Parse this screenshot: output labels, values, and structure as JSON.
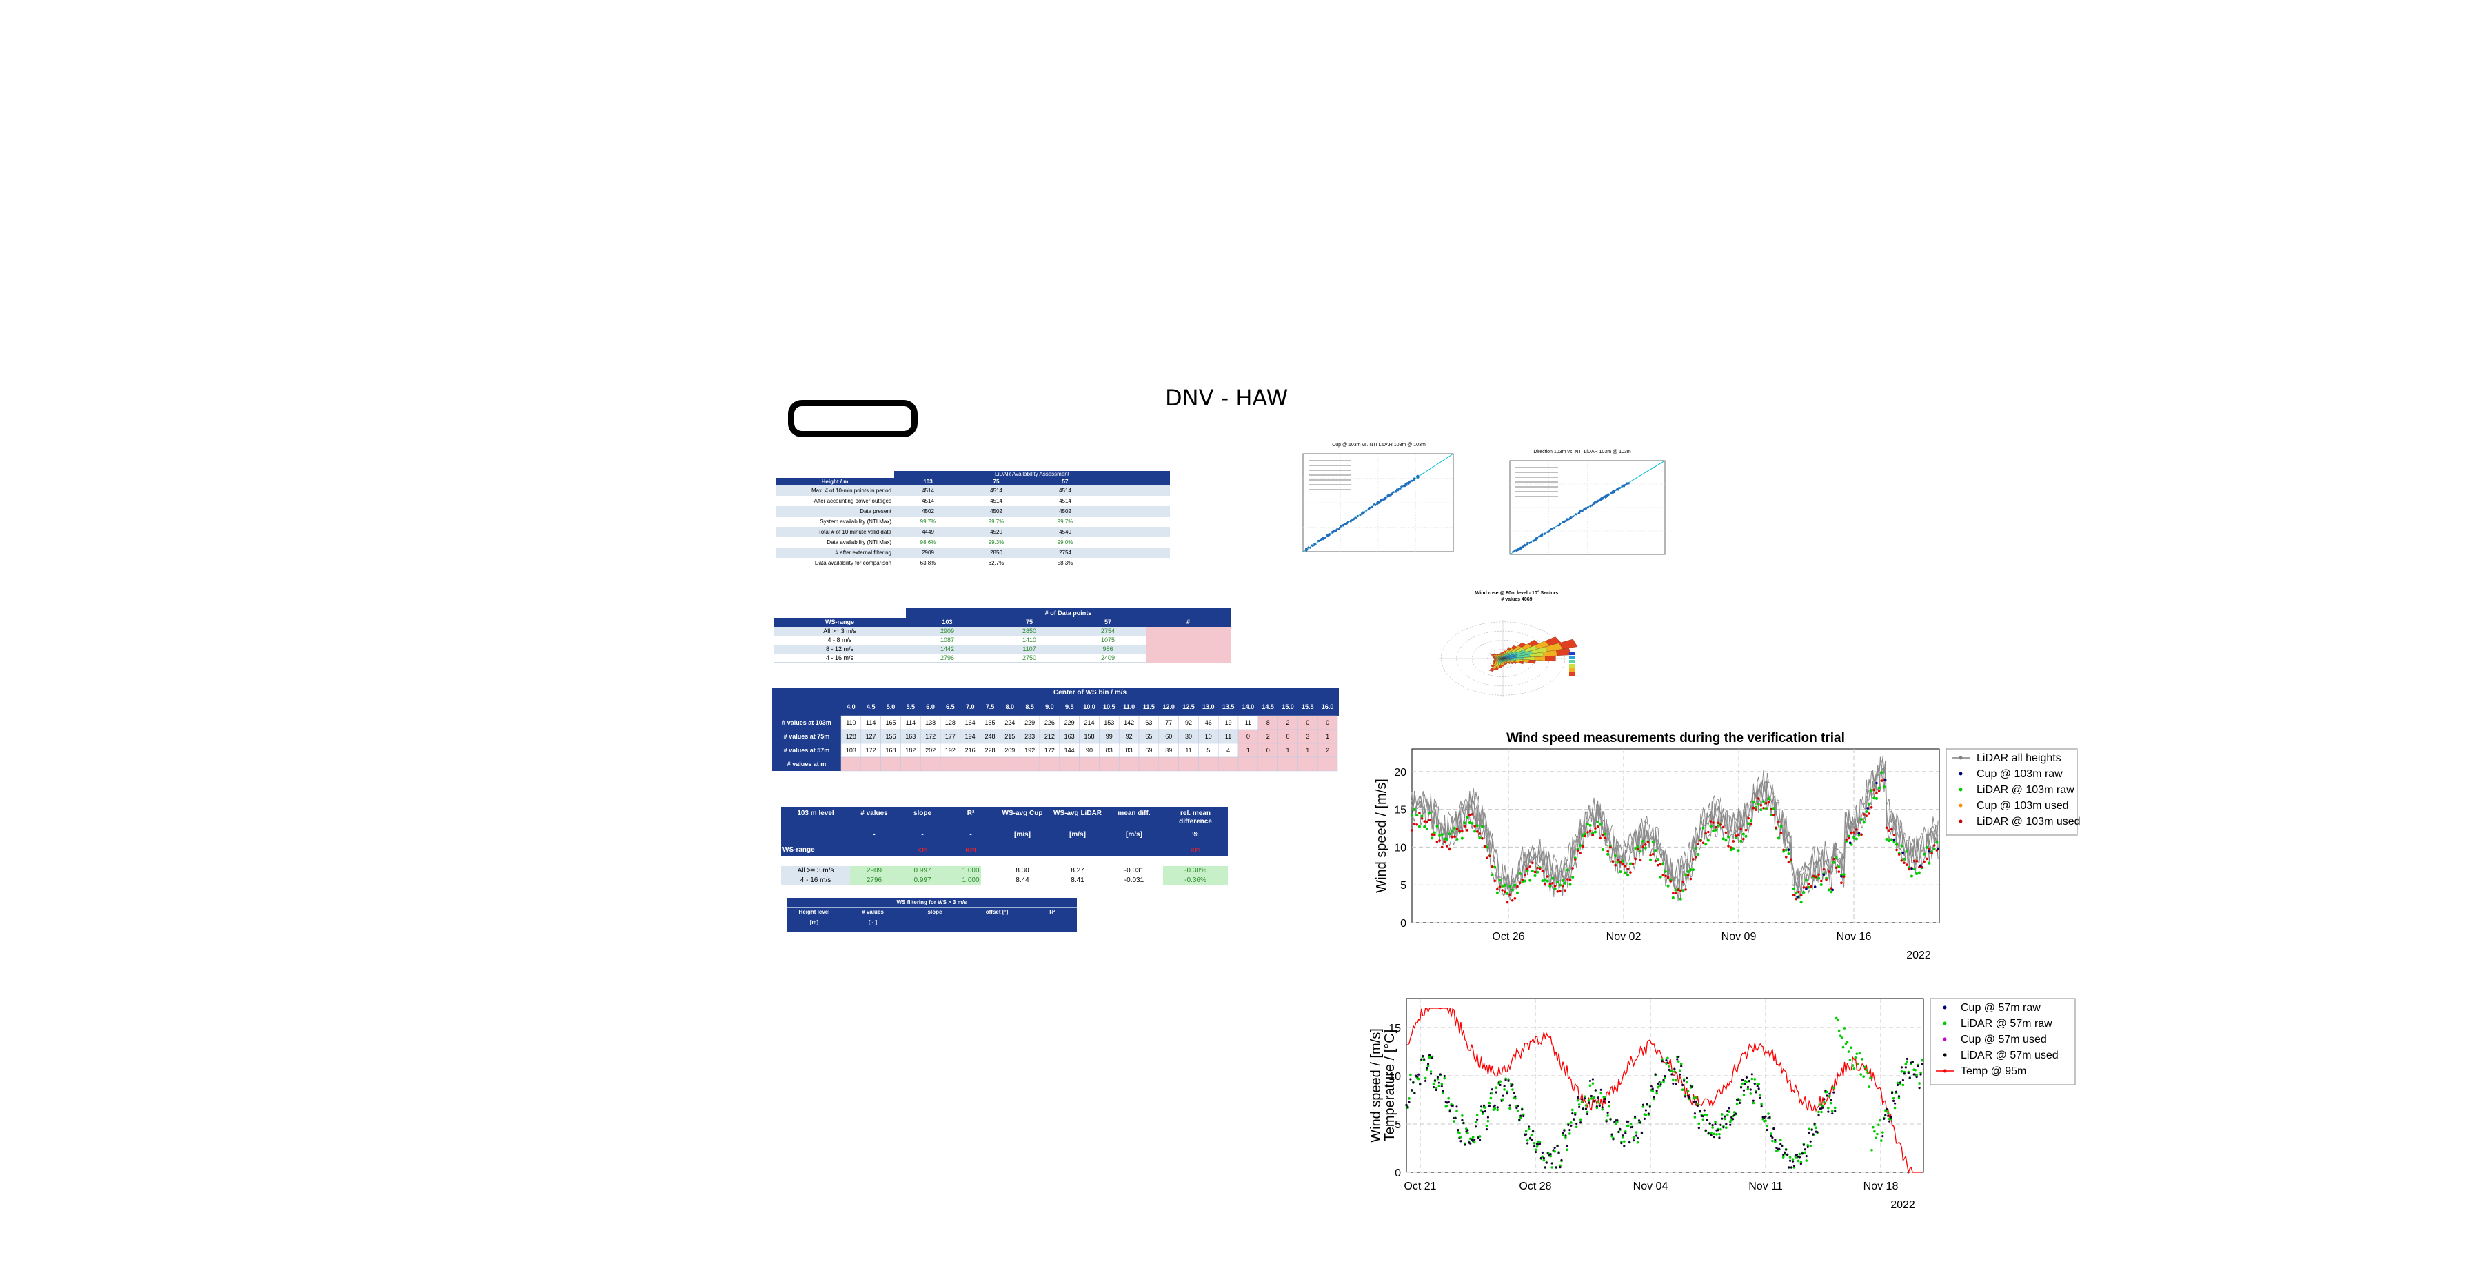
{
  "slide": {
    "title": "DNV - HAW"
  },
  "avail_table": {
    "super_header": "LiDAR Availability Assessment",
    "col_header": [
      "Height / m",
      "103",
      "75",
      "57"
    ],
    "rows": [
      [
        "Max. # of 10-min points in period",
        "4514",
        "4514",
        "4514"
      ],
      [
        "After accounting power outages",
        "4514",
        "4514",
        "4514"
      ],
      [
        "Data present",
        "4502",
        "4502",
        "4502"
      ],
      [
        "System availability (NTI Max)",
        "99.7%",
        "99.7%",
        "99.7%"
      ],
      [
        "Total # of 10 minute valid data",
        "4449",
        "4520",
        "4540"
      ],
      [
        "Data availability (NTI Max)",
        "98.6%",
        "99.3%",
        "99.0%"
      ],
      [
        "# after external filtering",
        "2909",
        "2850",
        "2754"
      ],
      [
        "Data availability for comparison",
        "63.8%",
        "62.7%",
        "58.3%"
      ]
    ]
  },
  "points_table": {
    "super_header": "# of Data points",
    "col_header": [
      "WS-range",
      "103",
      "75",
      "57",
      "#"
    ],
    "rows": [
      [
        "All >= 3 m/s",
        "2909",
        "2850",
        "2754",
        ""
      ],
      [
        "4 - 8 m/s",
        "1087",
        "1410",
        "1075",
        ""
      ],
      [
        "8 - 12 m/s",
        "1442",
        "1107",
        "986",
        ""
      ],
      [
        "4 - 16 m/s",
        "2796",
        "2750",
        "2409",
        ""
      ]
    ]
  },
  "bins_table": {
    "super_header": "Center of WS bin / m/s",
    "bins": [
      "4.0",
      "4.5",
      "5.0",
      "5.5",
      "6.0",
      "6.5",
      "7.0",
      "7.5",
      "8.0",
      "8.5",
      "9.0",
      "9.5",
      "10.0",
      "10.5",
      "11.0",
      "11.5",
      "12.0",
      "12.5",
      "13.0",
      "13.5",
      "14.0",
      "14.5",
      "15.0",
      "15.5",
      "16.0"
    ],
    "rows": [
      {
        "label": "# values at 103m",
        "values": [
          "110",
          "114",
          "165",
          "114",
          "138",
          "128",
          "164",
          "165",
          "224",
          "229",
          "226",
          "229",
          "214",
          "153",
          "142",
          "63",
          "77",
          "92",
          "46",
          "19",
          "11",
          "8",
          "2",
          "0",
          "0"
        ]
      },
      {
        "label": "# values at 75m",
        "values": [
          "128",
          "127",
          "156",
          "163",
          "172",
          "177",
          "194",
          "248",
          "215",
          "233",
          "212",
          "163",
          "158",
          "99",
          "92",
          "65",
          "60",
          "30",
          "10",
          "11",
          "0",
          "2",
          "0",
          "3",
          "1"
        ]
      },
      {
        "label": "# values at 57m",
        "values": [
          "103",
          "172",
          "168",
          "182",
          "202",
          "192",
          "216",
          "228",
          "209",
          "192",
          "172",
          "144",
          "90",
          "83",
          "83",
          "69",
          "39",
          "11",
          "5",
          "4",
          "1",
          "0",
          "1",
          "1",
          "2"
        ]
      },
      {
        "label": "# values at m",
        "values": []
      }
    ]
  },
  "reg_table": {
    "col_header": [
      "103 m level",
      "# values",
      "slope",
      "R²",
      "WS-avg Cup",
      "WS-avg LiDAR",
      "mean diff.",
      "rel. mean difference"
    ],
    "units": [
      "",
      "-",
      "-",
      "-",
      "[m/s]",
      "[m/s]",
      "[m/s]",
      "%"
    ],
    "sub_label": "WS-range",
    "criteria": [
      "",
      "",
      "KPI",
      "KPI",
      "",
      "",
      "",
      "KPI"
    ],
    "rows": [
      [
        "All >= 3 m/s",
        "2909",
        "0.997",
        "1.000",
        "8.30",
        "8.27",
        "-0.031",
        "-0.38%"
      ],
      [
        "4 - 16 m/s",
        "2796",
        "0.997",
        "1.000",
        "8.44",
        "8.41",
        "-0.031",
        "-0.36%"
      ]
    ]
  },
  "filter_table": {
    "super_header": "WS filtering for WS > 3 m/s",
    "col_header": [
      "Height level",
      "# values",
      "slope",
      "offset [°]",
      "R²"
    ],
    "units": [
      "[m]",
      "[ - ]",
      "",
      "",
      ""
    ]
  },
  "scatter1": {
    "title": "Cup @ 103m vs. NTI LiDAR 103m @ 103m"
  },
  "scatter2": {
    "title": "Direction 103m vs. NTI LiDAR 103m @ 103m"
  },
  "windrose": {
    "title": "Wind rose @ 80m level - 10° Sectors",
    "subtitle": "# values 4069"
  },
  "chart_data": [
    {
      "type": "line",
      "title": "Wind speed measurements during the verification trial",
      "ylabel": "Wind speed / [m/s]",
      "ylim": [
        0,
        23
      ],
      "yticks": [
        0,
        5,
        10,
        15,
        20
      ],
      "xticks": [
        "Oct 26",
        "Nov 02",
        "Nov 09",
        "Nov 16"
      ],
      "year_label": "2022",
      "grid": true,
      "legend_position": "right",
      "series": [
        {
          "name": "LiDAR all heights",
          "color": "#808080"
        },
        {
          "name": "Cup @ 103m raw",
          "color": "#000080"
        },
        {
          "name": "LiDAR @ 103m raw",
          "color": "#00cc00"
        },
        {
          "name": "Cup @ 103m used",
          "color": "#ff8c00"
        },
        {
          "name": "LiDAR @ 103m used",
          "color": "#cc0000"
        }
      ]
    },
    {
      "type": "line",
      "ylabel": "Wind speed / [m/s]",
      "ylabel2": "Temperature / [°C]",
      "ylim": [
        0,
        18
      ],
      "yticks": [
        0,
        5,
        10,
        15
      ],
      "xticks": [
        "Oct 21",
        "Oct 28",
        "Nov 04",
        "Nov 11",
        "Nov 18"
      ],
      "year_label": "2022",
      "grid": true,
      "legend_position": "right",
      "series": [
        {
          "name": "Cup @ 57m raw",
          "color": "#000080"
        },
        {
          "name": "LiDAR @ 57m raw",
          "color": "#00cc00"
        },
        {
          "name": "Cup @ 57m used",
          "color": "#cc00cc"
        },
        {
          "name": "LiDAR @ 57m used",
          "color": "#000000"
        },
        {
          "name": "Temp @ 95m",
          "color": "#ff0000"
        }
      ]
    }
  ]
}
